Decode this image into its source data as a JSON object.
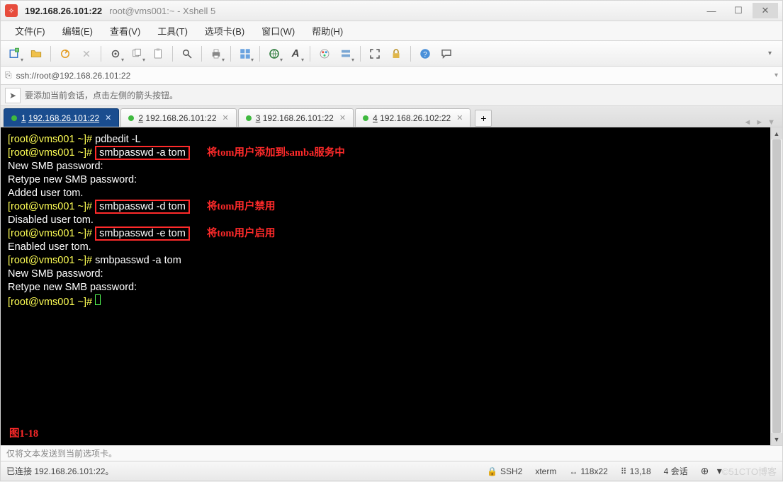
{
  "window": {
    "title_main": "192.168.26.101:22",
    "title_sub": "root@vms001:~ - Xshell 5"
  },
  "menu": {
    "file": "文件(F)",
    "edit": "编辑(E)",
    "view": "查看(V)",
    "tools": "工具(T)",
    "tabs": "选项卡(B)",
    "window": "窗口(W)",
    "help": "帮助(H)"
  },
  "toolbar_icons": {
    "new_session": "new-session",
    "open": "open",
    "reconnect": "reconnect",
    "disconnect": "disconnect",
    "properties": "properties",
    "copy": "copy",
    "paste": "paste",
    "find": "find",
    "print": "print",
    "layout": "layout",
    "encoding": "encoding",
    "font": "font",
    "colors": "colors",
    "hosts": "hosts",
    "fullscreen": "fullscreen",
    "lock": "lock",
    "help": "help",
    "chat": "chat"
  },
  "address": {
    "url": "ssh://root@192.168.26.101:22"
  },
  "hint": {
    "text": "要添加当前会话，点击左侧的箭头按钮。"
  },
  "tabs": [
    {
      "num": "1",
      "label": "192.168.26.101:22",
      "active": true
    },
    {
      "num": "2",
      "label": "192.168.26.101:22",
      "active": false
    },
    {
      "num": "3",
      "label": "192.168.26.101:22",
      "active": false
    },
    {
      "num": "4",
      "label": "192.168.26.102:22",
      "active": false
    }
  ],
  "terminal": {
    "lines": [
      {
        "prompt": "[root@vms001 ~]# ",
        "cmd_plain": "pdbedit -L"
      },
      {
        "prompt": "[root@vms001 ~]# ",
        "cmd_boxed": "smbpasswd -a tom",
        "anno": "将tom用户添加到samba服务中"
      },
      {
        "text": "New SMB password:"
      },
      {
        "text": "Retype new SMB password:"
      },
      {
        "text": "Added user tom."
      },
      {
        "prompt": "[root@vms001 ~]# ",
        "cmd_boxed": "smbpasswd -d tom",
        "anno": "将tom用户禁用"
      },
      {
        "text": "Disabled user tom."
      },
      {
        "prompt": "[root@vms001 ~]# ",
        "cmd_boxed": "smbpasswd -e tom",
        "anno": "将tom用户启用"
      },
      {
        "text": "Enabled user tom."
      },
      {
        "prompt": "[root@vms001 ~]# ",
        "cmd_plain": "smbpasswd -a tom"
      },
      {
        "text": "New SMB password:"
      },
      {
        "text": "Retype new SMB password:"
      },
      {
        "prompt": "[root@vms001 ~]# ",
        "cursor": true
      }
    ],
    "fig_label": "图1-18"
  },
  "input_hint": "仅将文本发送到当前选项卡。",
  "status": {
    "conn": "已连接 192.168.26.101:22。",
    "proto": "SSH2",
    "term": "xterm",
    "size": "118x22",
    "pos": "13,18",
    "sessions": "4 会话",
    "watermark": "©51CTO博客"
  },
  "glyphs": {
    "min": "—",
    "max": "☐",
    "close": "✕",
    "up": "▲",
    "down": "▼",
    "arrow": "➤",
    "plus": "+",
    "prev": "◄",
    "next": "►",
    "bars": "≡",
    "lock": "🔒",
    "size_ico": "↔",
    "pos_ico": "⠿"
  }
}
